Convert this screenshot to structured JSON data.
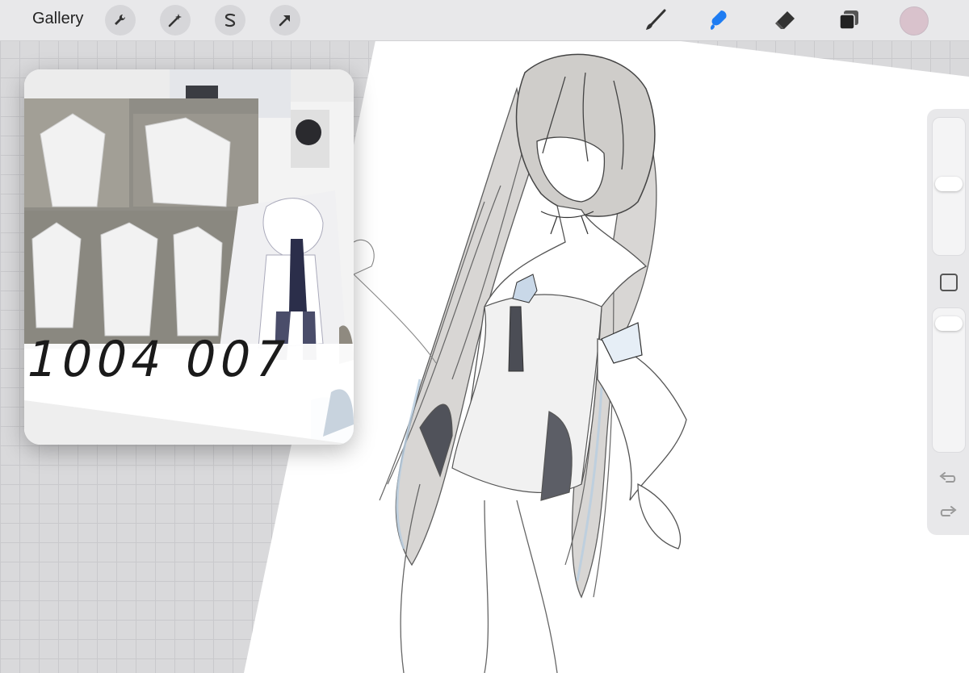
{
  "top_bar": {
    "gallery_label": "Gallery",
    "left_tools": [
      "wrench-icon",
      "magic-wand-icon",
      "selection-s-icon",
      "arrow-icon"
    ],
    "right_tools": [
      "brush-icon",
      "smudge-icon",
      "eraser-icon",
      "layers-icon"
    ],
    "active_tool": "smudge-icon",
    "active_color": "#d9c2cc",
    "accent_color": "#1e7cf2"
  },
  "reference": {
    "caption": "1004 007"
  },
  "side_panel": {
    "controls": [
      "brush-size-slider",
      "modify-button",
      "opacity-slider",
      "undo-icon",
      "redo-icon"
    ]
  }
}
